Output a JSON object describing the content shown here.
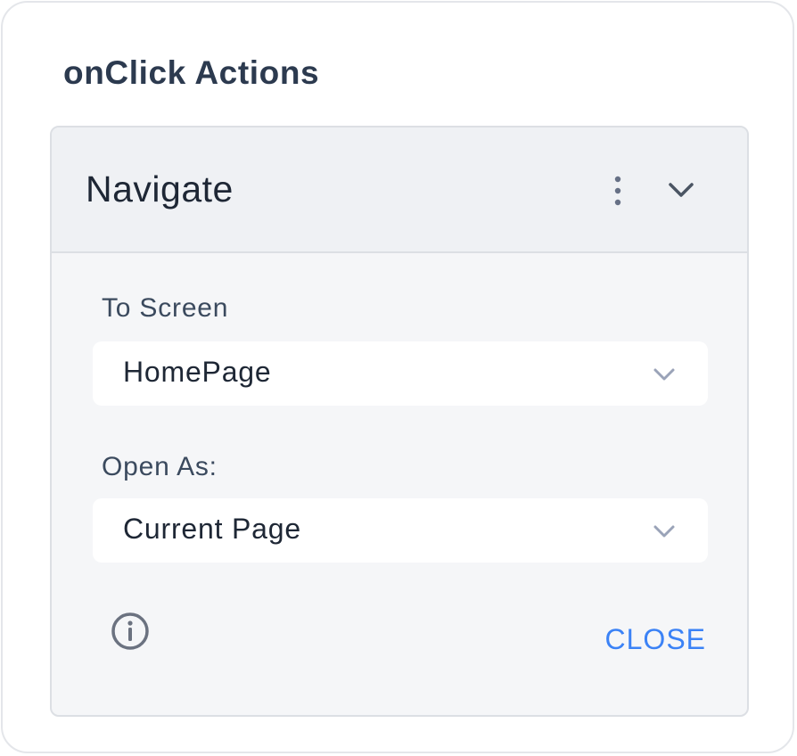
{
  "section": {
    "title": "onClick Actions"
  },
  "action_card": {
    "title": "Navigate",
    "menu_icon": "kebab-vertical-icon",
    "collapse_icon": "chevron-down-icon"
  },
  "fields": {
    "to_screen": {
      "label": "To Screen",
      "value": "HomePage"
    },
    "open_as": {
      "label": "Open As:",
      "value": "Current Page"
    }
  },
  "footer": {
    "info_icon": "info-icon",
    "close_label": "CLOSE"
  },
  "colors": {
    "accent": "#3b82f6",
    "card_bg": "#f5f6f8",
    "header_bg": "#eff1f4",
    "text_dark": "#1e2735",
    "icon_gray": "#667085"
  }
}
